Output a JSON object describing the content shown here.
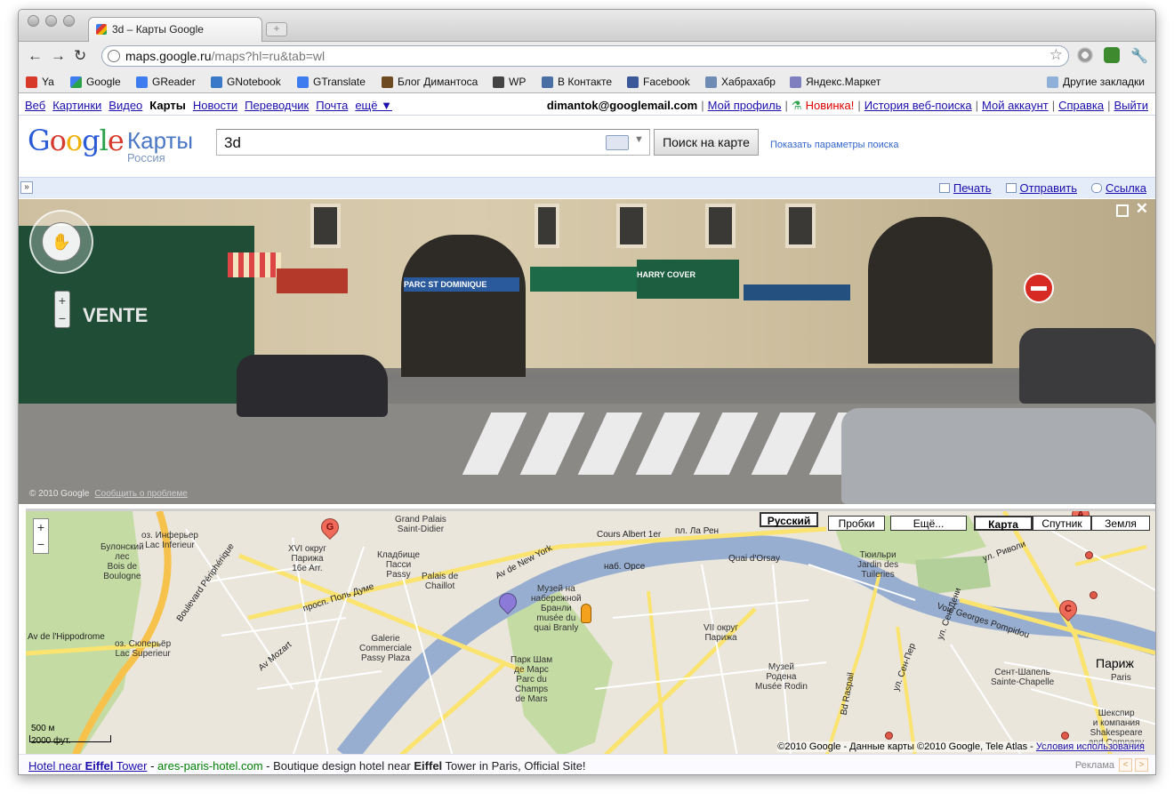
{
  "browser": {
    "tab_title": "3d – Карты Google",
    "url_host": "maps.google.ru",
    "url_path": "/maps?hl=ru&tab=wl"
  },
  "bookmarks": [
    {
      "label": "Ya",
      "color": "#d83a2a"
    },
    {
      "label": "Google",
      "color": "#3e7df0"
    },
    {
      "label": "GReader",
      "color": "#3e7df0"
    },
    {
      "label": "GNotebook",
      "color": "#3a78c8"
    },
    {
      "label": "GTranslate",
      "color": "#3e7df0"
    },
    {
      "label": "Блог Димантоса",
      "color": "#6e4a20"
    },
    {
      "label": "WP",
      "color": "#444444"
    },
    {
      "label": "В Контакте",
      "color": "#4a6fa5"
    },
    {
      "label": "Facebook",
      "color": "#3b5998"
    },
    {
      "label": "Хабрахабр",
      "color": "#6f8db4"
    },
    {
      "label": "Яндекс.Маркет",
      "color": "#7f7fbf"
    }
  ],
  "bookmarks_other": "Другие закладки",
  "gbar": {
    "left": [
      "Веб",
      "Картинки",
      "Видео",
      "Карты",
      "Новости",
      "Переводчик",
      "Почта",
      "ещё ▼"
    ],
    "current": "Карты",
    "email": "dimantok@googlemail.com",
    "profile": "Мой профиль",
    "new": "Новинка!",
    "history": "История веб-поиска",
    "account": "Мой аккаунт",
    "help": "Справка",
    "logout": "Выйти"
  },
  "header": {
    "maps_word": "Карты",
    "country": "Россия",
    "query": "3d",
    "search_button": "Поиск на карте",
    "search_options": "Показать параметры поиска"
  },
  "actions": {
    "print": "Печать",
    "send": "Отправить",
    "link": "Ссылка"
  },
  "streetview": {
    "copyright": "© 2010 Google",
    "report": "Сообщить о проблеме",
    "vente": "VENTE",
    "parc_sign": "PARC ST DOMINIQUE",
    "shop_sign": "HARRY COVER"
  },
  "map": {
    "language_button": "Русский",
    "traffic": "Пробки",
    "more": "Ещё...",
    "types": [
      "Карта",
      "Спутник",
      "Земля"
    ],
    "selected_type": "Карта",
    "scale_metric": "500 м",
    "scale_imperial": "2000 фут.",
    "copyright": "©2010 Google - Данные карты ©2010 Google, Tele Atlas -",
    "terms": "Условия использования",
    "labels": {
      "boulogne": "Булонский\nлес\nBois de\nBoulogne",
      "lac_inf": "оз. Инферьер\nLac Inferieur",
      "xvi": "XVI округ\nПарижа\n16e Arr.",
      "cemetery_passy": "Кладбище\nПасси\nPassy",
      "palais_chaillot": "Palais de\nChaillot",
      "gare_sud": "Grand Palais\nSaint-Didier",
      "cours_albert": "Cours Albert 1er",
      "pl_la_ren": "пл. Ла Рен",
      "av_new_york": "Av de New York",
      "nab_orse": "наб. Орсе",
      "quai_orsay": "Quai d'Orsay",
      "tuileries": "Тюильри\nJardin des\nTuileries",
      "rivoli": "ул. Риволи",
      "museum_branly": "Музей на\nнабережной\nБранли\nmusée du\nquai Branly",
      "champ_mars": "Парк Шам\nде Марс\nParc du\nChamps\nde Mars",
      "vii": "VII округ\nПарижа",
      "rodin": "Музей\nРодена\nMusée Rodin",
      "paris": "Париж",
      "paris_sub": "Paris",
      "sainte_chapelle": "Сент-Шапель\nSainte-Chapelle",
      "shakespeare": "Шекспир\nи компания\nShakespeare\nand Company",
      "voie_pompidou": "Voie Georges Pompidou",
      "av_hippodrome": "Av de l'Hippodrome",
      "lac_sup": "оз. Сюперьёр\nLac Superieur",
      "galerie_passy": "Galerie\nCommerciale\nPassy Plaza",
      "bd_peripherique": "Boulevard Périphérique",
      "av_mozart": "Av Mozart",
      "pr_paul_doumer": "просп. Поль Думе",
      "bd_raspail": "Bd Raspail",
      "ul_sen_per": "ул. Сен-Пер",
      "ul_sen_dome": "ул. Сен-Дени"
    }
  },
  "ad": {
    "title_pre": "Hotel near ",
    "title_bold": "Eiffel",
    "title_post": " Tower",
    "url": "ares-paris-hotel.com",
    "desc_pre": " - Boutique design hotel near ",
    "desc_bold": "Eiffel",
    "desc_post": " Tower in Paris, Official Site!",
    "label": "Реклама"
  }
}
